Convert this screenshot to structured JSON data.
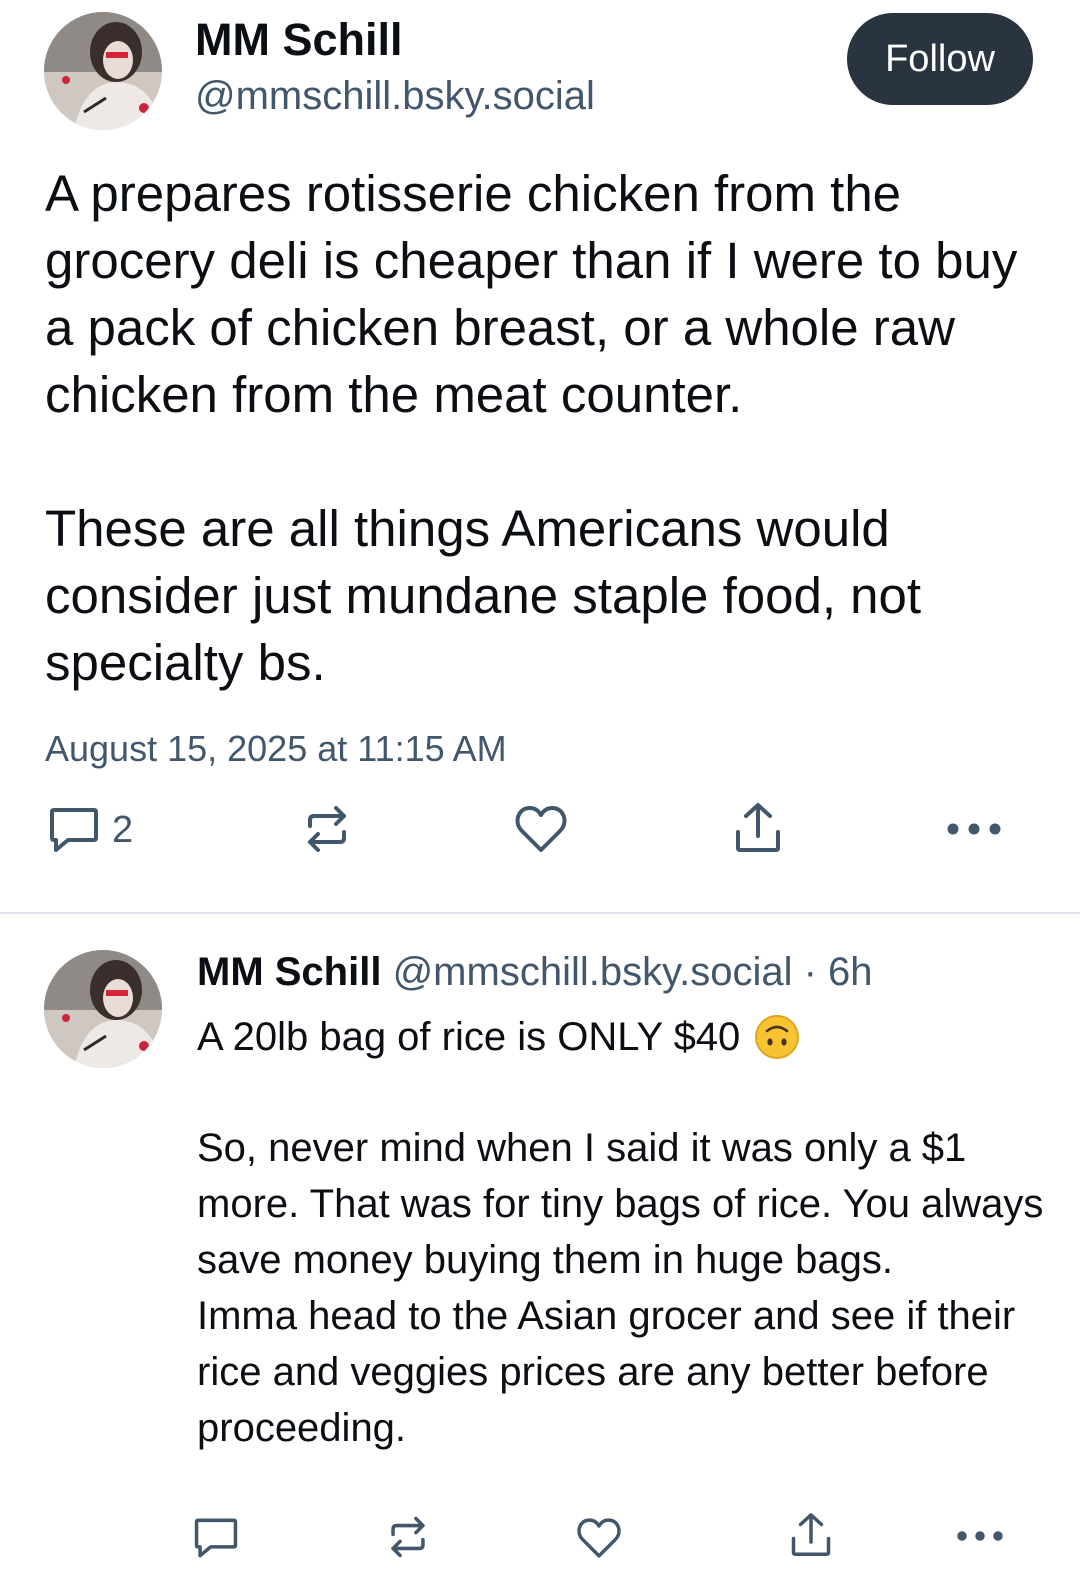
{
  "post": {
    "author_name": "MM Schill",
    "author_handle": "@mmschill.bsky.social",
    "follow_label": "Follow",
    "text": "A prepares rotisserie chicken from the grocery deli is cheaper than if I were to buy a pack of chicken breast, or a whole raw chicken from the meat counter.\n\nThese are all things Americans would consider just mundane staple food, not specialty bs.",
    "timestamp": "August 15, 2025 at 11:15 AM",
    "actions": {
      "reply_icon": "speech-bubble-icon",
      "reply_count": "2",
      "repost_icon": "repost-icon",
      "like_icon": "heart-icon",
      "share_icon": "share-icon",
      "more_icon": "more-dots-icon"
    }
  },
  "reply": {
    "author_name": "MM Schill",
    "author_meta": "@mmschill.bsky.social · 6h",
    "first_line": "A 20lb bag of rice is ONLY $40",
    "emoji": "upside-down-face",
    "body": "So, never mind when I said it was only a $1 more. That was for tiny bags of rice. You always save money buying them in huge bags.\nImma head to the Asian grocer and see if their rice and veggies prices are any better before proceeding.",
    "actions": {
      "reply_icon": "speech-bubble-icon",
      "repost_icon": "repost-icon",
      "like_icon": "heart-icon",
      "share_icon": "share-icon",
      "more_icon": "more-dots-icon"
    }
  },
  "colors": {
    "text_primary": "#0b0f14",
    "text_secondary": "#42576c",
    "follow_button_bg": "#2a3440",
    "divider": "#dfe4ea"
  }
}
